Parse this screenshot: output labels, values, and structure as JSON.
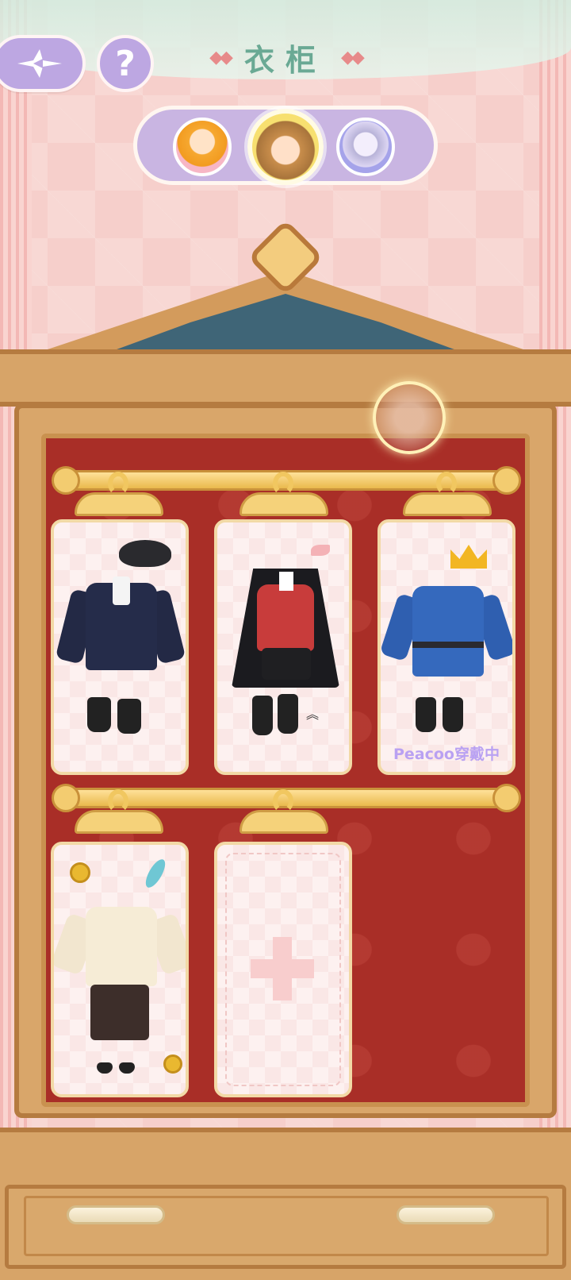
{
  "header": {
    "title": "衣柜",
    "back_icon": "sparkle-arrow-back-icon",
    "help_label": "?"
  },
  "characters": [
    {
      "name": "character-1",
      "selected": false
    },
    {
      "name": "character-2",
      "selected": true
    },
    {
      "name": "character-3",
      "selected": false
    }
  ],
  "wardrobe": {
    "outfits": [
      {
        "id": "outfit-1",
        "theme": "black-suit",
        "wearing_label": ""
      },
      {
        "id": "outfit-2",
        "theme": "vampire",
        "wearing_label": ""
      },
      {
        "id": "outfit-3",
        "theme": "blue-prince",
        "wearing_label": "Peacoo穿戴中"
      },
      {
        "id": "outfit-4",
        "theme": "chinese-style",
        "wearing_label": ""
      }
    ],
    "add_slot_icon": "plus-icon"
  },
  "colors": {
    "accent_purple": "#bda7e2",
    "title_green": "#6aa994",
    "wardrobe_wood": "#d9a66a",
    "wardrobe_interior": "#a92e27",
    "wearing_text": "#b9a1f2"
  }
}
